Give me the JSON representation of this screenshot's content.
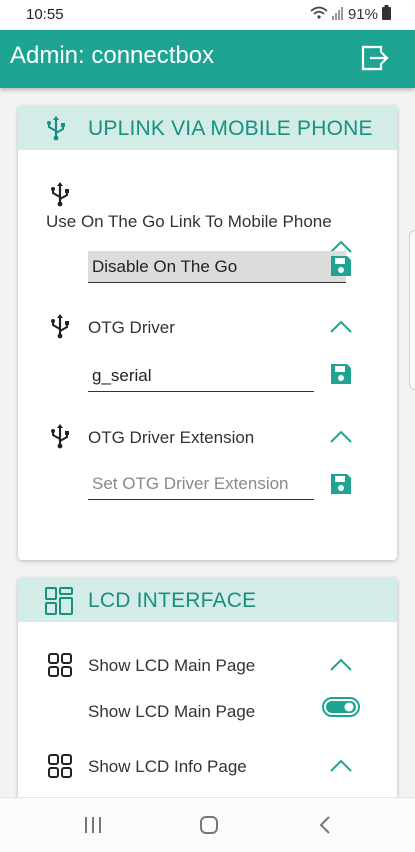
{
  "status": {
    "time": "10:55",
    "battery": "91%"
  },
  "appbar": {
    "title": "Admin: connectbox",
    "exit_icon": "logout-icon"
  },
  "uplink": {
    "title": "UPLINK VIA MOBILE PHONE",
    "icon": "usb-icon",
    "otg_link": {
      "label": "Use On The Go Link To Mobile Phone",
      "value": "Disable On The Go"
    },
    "otg_driver": {
      "label": "OTG Driver",
      "value": "g_serial"
    },
    "otg_driver_ext": {
      "label": "OTG Driver Extension",
      "placeholder": "Set OTG Driver Extension"
    }
  },
  "lcd": {
    "title": "LCD INTERFACE",
    "icon": "grid-icon",
    "main_page": {
      "label": "Show LCD Main Page",
      "toggle_label": "Show LCD Main Page",
      "enabled": true
    },
    "info_page": {
      "label": "Show LCD Info Page"
    }
  },
  "colors": {
    "accent": "#1ea492",
    "header_bg": "#d4ece7",
    "header_text": "#17907f"
  }
}
